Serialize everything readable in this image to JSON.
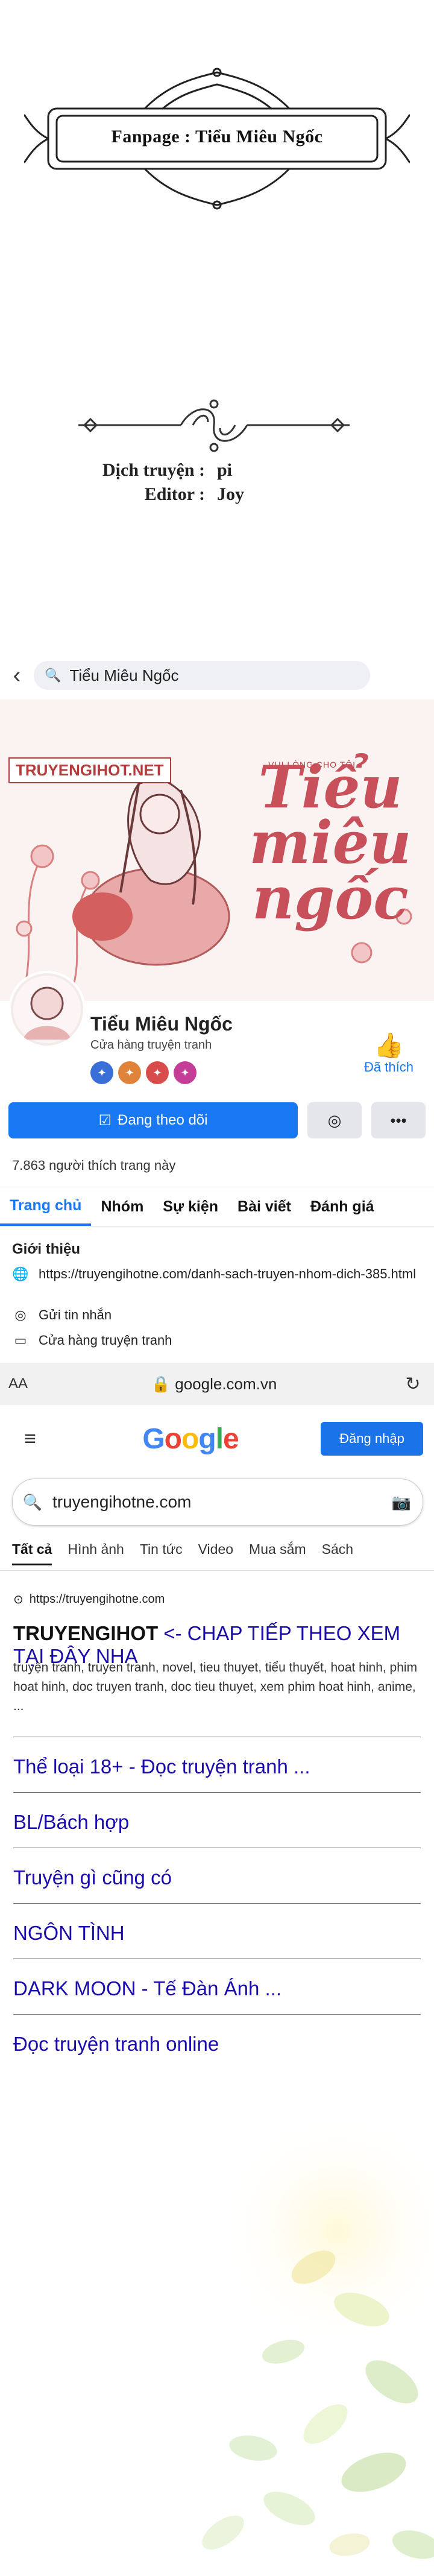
{
  "banner": {
    "text": "Fanpage : Tiểu Miêu Ngốc"
  },
  "credits": [
    {
      "label": "Dịch truyện :",
      "value": "pi"
    },
    {
      "label": "Editor :",
      "value": "Joy"
    }
  ],
  "facebook": {
    "search_query": "Tiểu Miêu Ngốc",
    "cover": {
      "site_tag": "TRUYENGIHOT.NET",
      "subtitle": "VUI LÒNG CHO TÔI",
      "title_art": "Tiểu miêu ngốc"
    },
    "page_name": "Tiểu Miêu Ngốc",
    "category": "Cửa hàng truyện tranh",
    "liked_label": "Đã thích",
    "following_label": "Đang theo dõi",
    "message_icon": "messenger-icon",
    "more_label": "•••",
    "likes_count": "7.863 người thích trang này",
    "tabs": [
      "Trang chủ",
      "Nhóm",
      "Sự kiện",
      "Bài viết",
      "Đánh giá"
    ],
    "intro_title": "Giới thiệu",
    "intro_link": "https://truyengihotne.com/danh-sach-truyen-nhom-dich-385.html",
    "send_message": "Gửi tin nhắn",
    "store_label": "Cửa hàng truyện tranh",
    "colors": {
      "accent": "#1877f2"
    }
  },
  "browser": {
    "aa": "AA",
    "url": "google.com.vn"
  },
  "google": {
    "logo": [
      "G",
      "o",
      "o",
      "g",
      "l",
      "e"
    ],
    "login_label": "Đăng nhập",
    "query": "truyengihotne.com",
    "tabs": [
      "Tất cả",
      "Hình ảnh",
      "Tin tức",
      "Video",
      "Mua sắm",
      "Sách"
    ],
    "result": {
      "source": "https://truyengihotne.com",
      "title_brand": "TRUYENGIHOT",
      "title_rest": " <- CHAP TIẾP THEO XEM TẠI ĐÂY NHA",
      "snippet": "truyện tranh, truyen tranh, novel, tieu thuyet, tiểu thuyết, hoat hinh, phim hoat hinh, doc truyen tranh, doc tieu thuyet, xem phim hoat hinh, anime, ...",
      "sitelinks": [
        "Thể loại 18+ - Đọc truyện tranh ...",
        "BL/Bách hợp",
        "Truyện gì cũng có",
        "NGÔN TÌNH",
        "DARK MOON - Tế Đàn Ánh ...",
        "Đọc truyện tranh online"
      ]
    }
  }
}
